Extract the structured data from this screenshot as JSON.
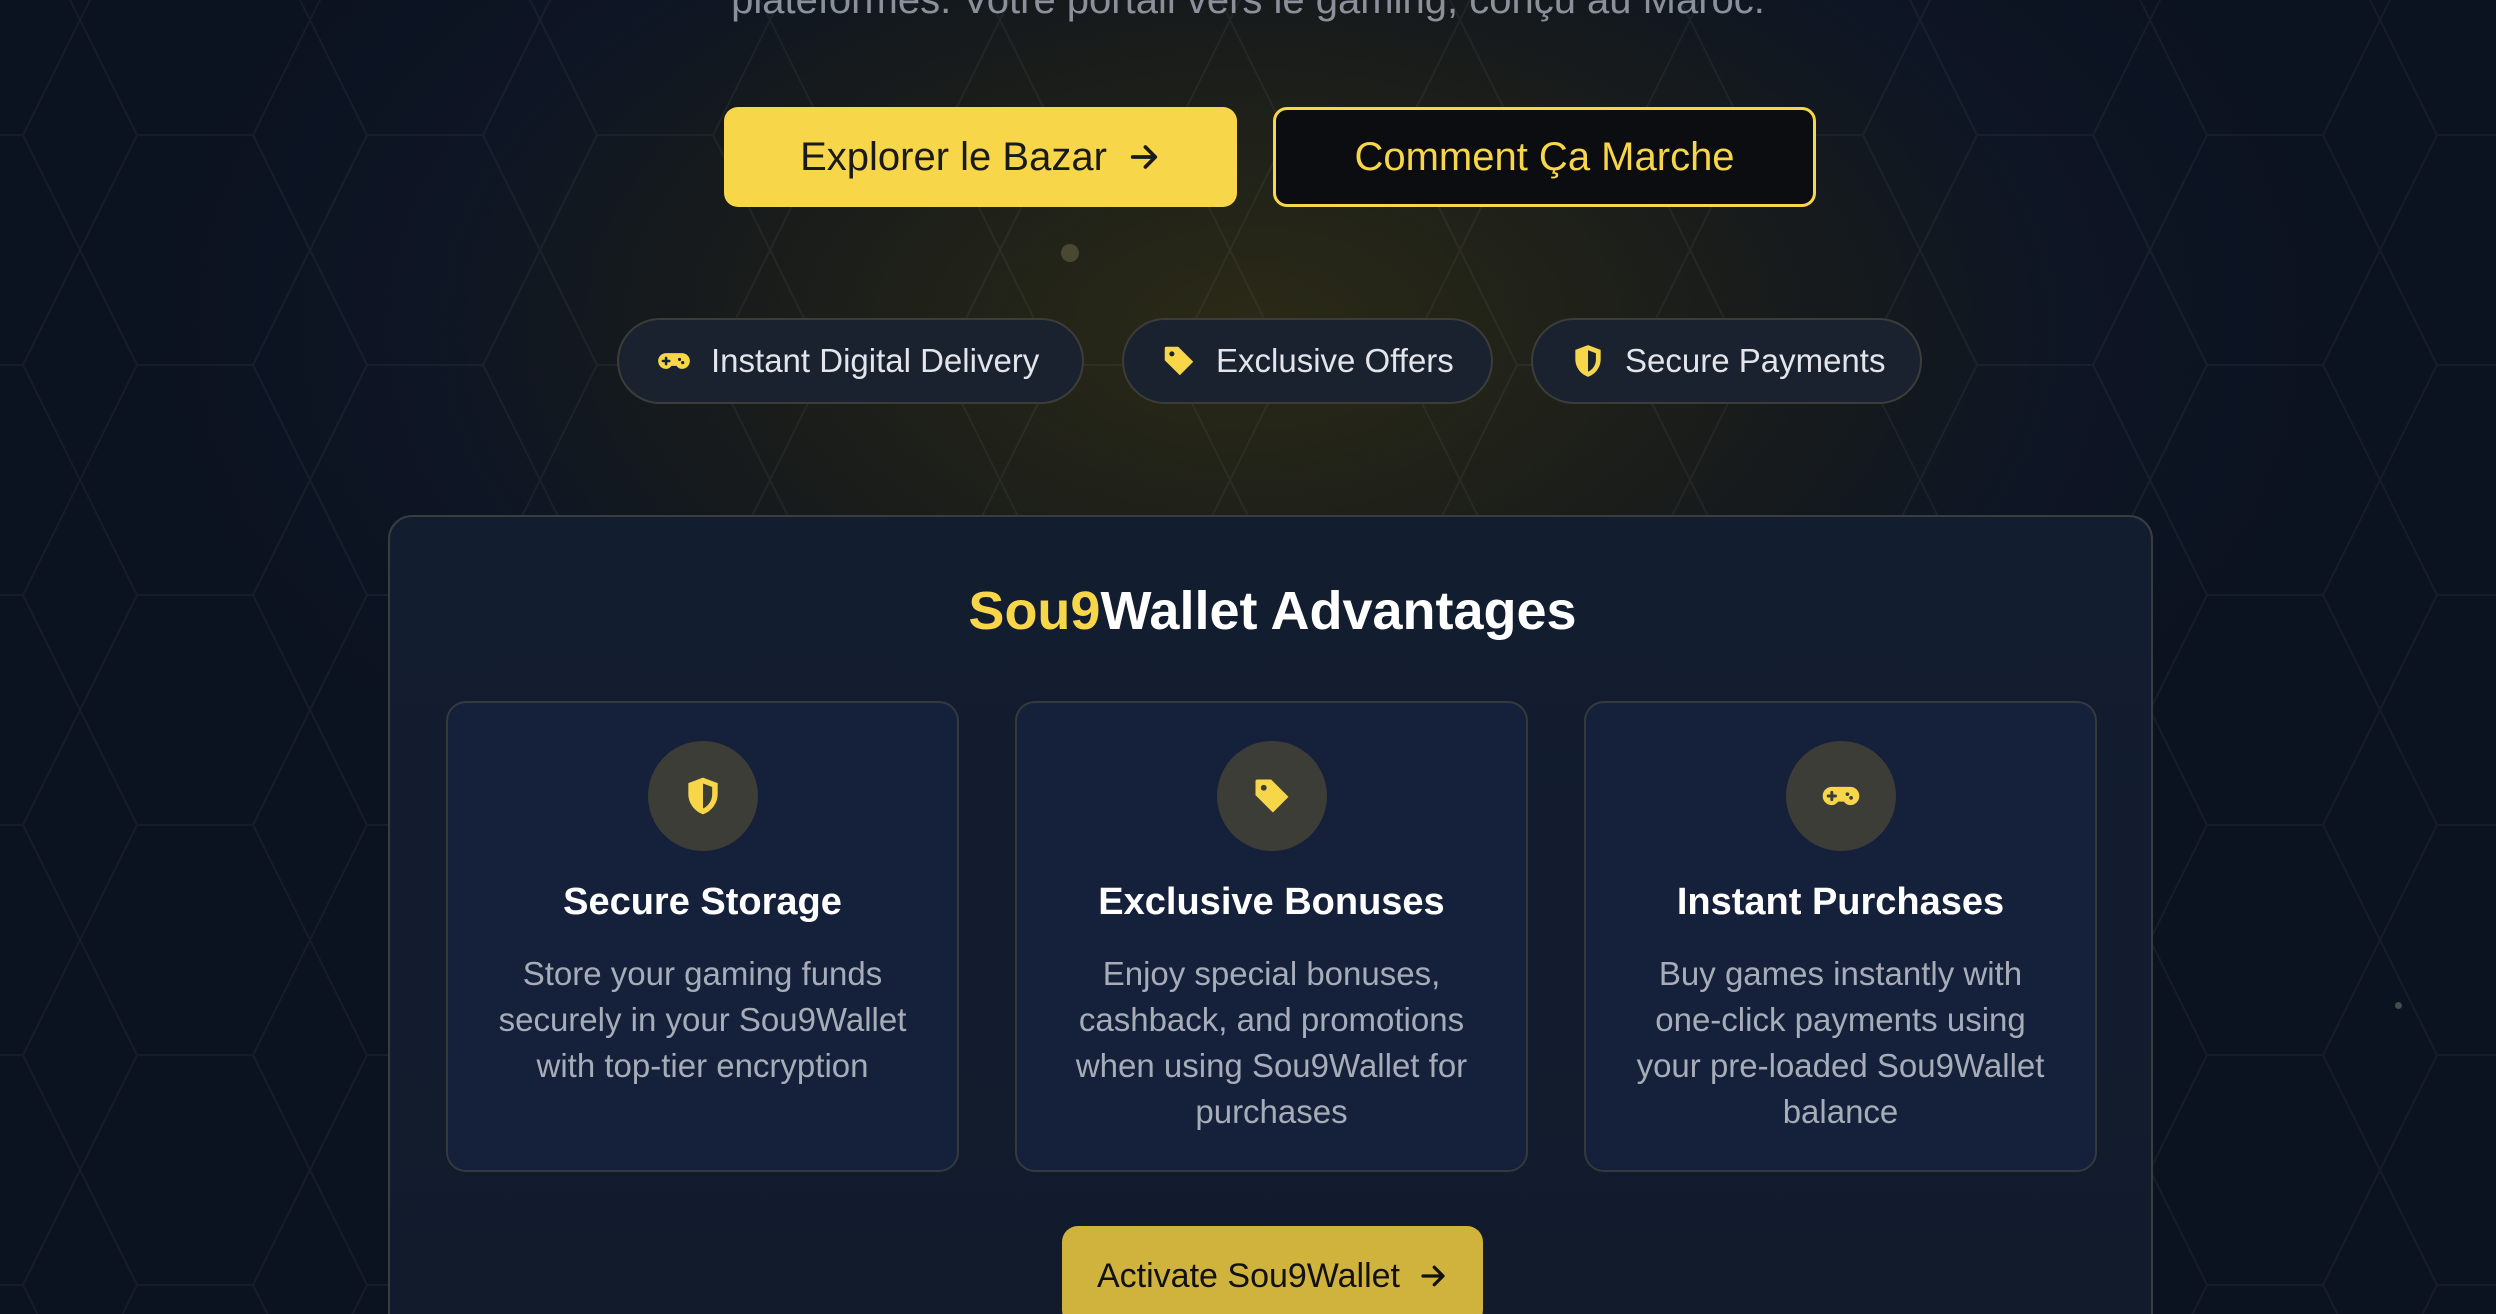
{
  "colors": {
    "accent": "#f7d64a",
    "background": "#0e1524",
    "panel": "#131d30",
    "card": "#15203a",
    "muted_text": "#a7adb8"
  },
  "hero": {
    "subtitle": "plateformes. Votre portail vers le gaming, conçu au Maroc.",
    "primary_button": {
      "label": "Explorer le Bazar",
      "icon": "arrow-right-icon"
    },
    "secondary_button": {
      "label": "Comment Ça Marche"
    }
  },
  "features": [
    {
      "label": "Instant Digital Delivery",
      "icon": "gamepad-icon"
    },
    {
      "label": "Exclusive Offers",
      "icon": "tag-icon"
    },
    {
      "label": "Secure Payments",
      "icon": "shield-icon"
    }
  ],
  "wallet": {
    "title_accent": "Sou9",
    "title_rest": "Wallet Advantages",
    "cards": [
      {
        "icon": "shield-icon",
        "title": "Secure Storage",
        "description": "Store your gaming funds securely in your Sou9Wallet with top-tier encryption"
      },
      {
        "icon": "tag-icon",
        "title": "Exclusive Bonuses",
        "description": "Enjoy special bonuses, cashback, and promotions when using Sou9Wallet for purchases"
      },
      {
        "icon": "gamepad-icon",
        "title": "Instant Purchases",
        "description": "Buy games instantly with one-click payments using your pre-loaded Sou9Wallet balance"
      }
    ],
    "cta": {
      "label": "Activate Sou9Wallet",
      "icon": "arrow-right-icon"
    }
  }
}
